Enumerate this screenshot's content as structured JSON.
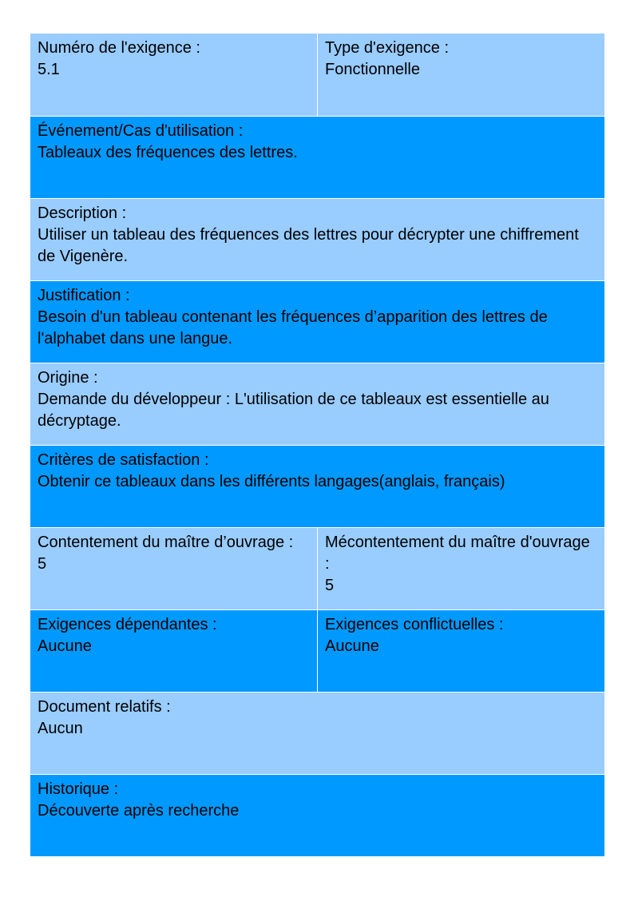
{
  "colors": {
    "light": "#99ccff",
    "dark": "#0099ff"
  },
  "numero": {
    "label": "Numéro de l'exigence :",
    "value": "5.1"
  },
  "type": {
    "label": "Type d'exigence :",
    "value": "Fonctionnelle"
  },
  "evenement": {
    "label": "Événement/Cas d'utilisation :",
    "value": "Tableaux des fréquences des lettres."
  },
  "description": {
    "label": "Description :",
    "value": "Utiliser un tableau des fréquences des lettres pour décrypter une chiffrement de Vigenère."
  },
  "justification": {
    "label": "Justification :",
    "value": "Besoin d'un tableau contenant les fréquences d’apparition des lettres de l'alphabet dans une langue."
  },
  "origine": {
    "label": "Origine :",
    "value": "Demande du développeur : L'utilisation de ce tableaux est essentielle au décryptage."
  },
  "criteres": {
    "label": "Critères de satisfaction :",
    "value": "Obtenir ce tableaux dans les différents langages(anglais, français)"
  },
  "contentement": {
    "label": "Contentement du maître d’ouvrage :",
    "value": "5"
  },
  "mecontentement": {
    "label": "Mécontentement du maître d'ouvrage :",
    "value": "5"
  },
  "dependantes": {
    "label": "Exigences dépendantes :",
    "value": "Aucune"
  },
  "conflictuelles": {
    "label": "Exigences conflictuelles :",
    "value": "Aucune"
  },
  "documents": {
    "label": "Document relatifs :",
    "value": "Aucun"
  },
  "historique": {
    "label": "Historique :",
    "value": "Découverte après recherche"
  }
}
